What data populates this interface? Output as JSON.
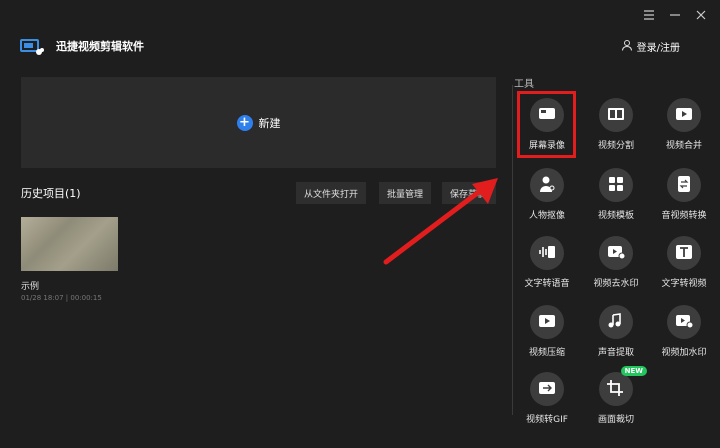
{
  "app": {
    "title": "迅捷视频剪辑软件",
    "login_label": "登录/注册"
  },
  "new_project": {
    "label": "新建"
  },
  "history": {
    "title": "历史项目(1)",
    "buttons": [
      "从文件夹打开",
      "批量管理",
      "保存草稿"
    ],
    "projects": [
      {
        "name": "示例",
        "meta": "01/28 18:07 | 00:00:15"
      }
    ]
  },
  "tools": {
    "title": "工具",
    "items": [
      {
        "label": "屏幕录像",
        "icon": "screen-record-icon"
      },
      {
        "label": "视频分割",
        "icon": "video-split-icon"
      },
      {
        "label": "视频合并",
        "icon": "video-merge-icon"
      },
      {
        "label": "人物抠像",
        "icon": "person-cutout-icon"
      },
      {
        "label": "视频模板",
        "icon": "video-template-icon"
      },
      {
        "label": "音视频转换",
        "icon": "av-convert-icon"
      },
      {
        "label": "文字转语音",
        "icon": "text-to-speech-icon"
      },
      {
        "label": "视频去水印",
        "icon": "remove-watermark-icon"
      },
      {
        "label": "文字转视频",
        "icon": "text-to-video-icon"
      },
      {
        "label": "视频压缩",
        "icon": "video-compress-icon"
      },
      {
        "label": "声音提取",
        "icon": "audio-extract-icon"
      },
      {
        "label": "视频加水印",
        "icon": "add-watermark-icon"
      },
      {
        "label": "视频转GIF",
        "icon": "video-to-gif-icon"
      },
      {
        "label": "画面裁切",
        "icon": "crop-icon",
        "badge": "NEW"
      }
    ]
  },
  "colors": {
    "background": "#1e1e1e",
    "panel": "#2b2b2b",
    "accent_blue": "#2f80ed",
    "highlight_red": "#e11d1d",
    "badge_green": "#22c55e"
  }
}
